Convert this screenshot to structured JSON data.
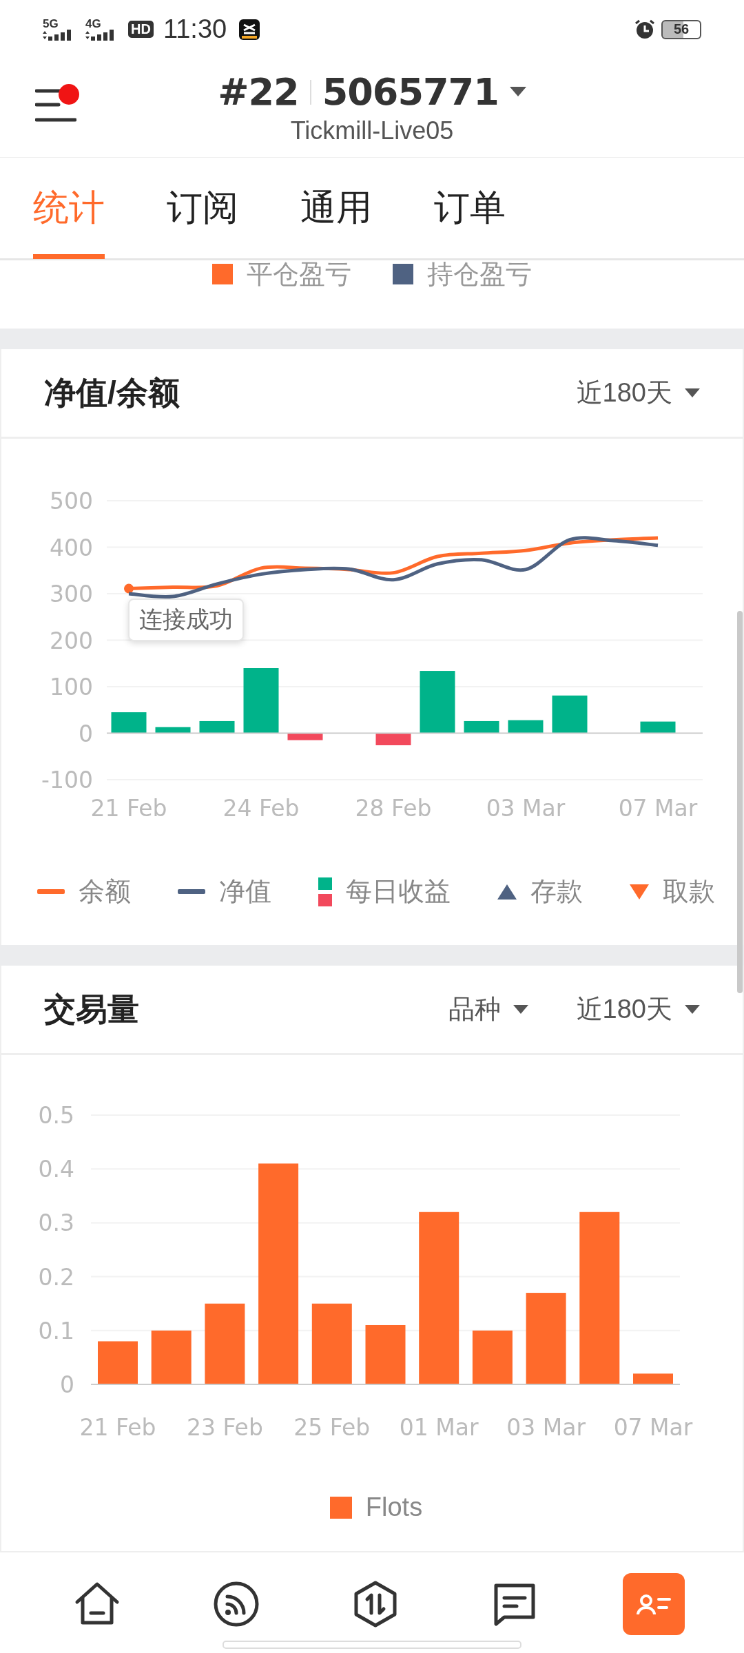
{
  "status_bar": {
    "network_1": "5G",
    "network_2": "4G",
    "hd": "HD",
    "time": "11:30",
    "battery": "56"
  },
  "header": {
    "account_number": "#22",
    "account_id": "5065771",
    "server": "Tickmill-Live05",
    "has_notification": true
  },
  "tabs": [
    {
      "label": "统计",
      "selected": true
    },
    {
      "label": "订阅",
      "selected": false
    },
    {
      "label": "通用",
      "selected": false
    },
    {
      "label": "订单",
      "selected": false
    }
  ],
  "previous_chart_legend": [
    {
      "label": "平仓盈亏",
      "color": "#ff6a2b"
    },
    {
      "label": "持仓盈亏",
      "color": "#4f6282"
    }
  ],
  "equity_card": {
    "title": "净值/余额",
    "dropdowns": [
      {
        "label": "近180天"
      }
    ],
    "toast": "连接成功",
    "chart_data": {
      "type": "bar",
      "categories": [
        "21 Feb",
        null,
        null,
        "24 Feb",
        null,
        null,
        "28 Feb",
        null,
        null,
        "03 Mar",
        null,
        null,
        "07 Mar"
      ],
      "ylim": [
        -100,
        500
      ],
      "yticks": [
        -100,
        0,
        100,
        200,
        300,
        400,
        500
      ],
      "grid": true,
      "series": [
        {
          "name": "余额",
          "type": "line",
          "color": "#ff6a2b",
          "values": [
            311,
            314,
            317,
            355,
            355,
            352,
            345,
            380,
            387,
            393,
            409,
            416,
            420
          ]
        },
        {
          "name": "净值",
          "type": "line",
          "color": "#4f6282",
          "values": [
            300,
            294,
            321,
            342,
            352,
            353,
            330,
            364,
            373,
            352,
            416,
            414,
            404
          ]
        },
        {
          "name": "每日收益",
          "type": "bar",
          "color": "#00b38a",
          "values": [
            45,
            13,
            26,
            140,
            null,
            null,
            null,
            134,
            26,
            28,
            81,
            null,
            25
          ]
        },
        {
          "type": "bar",
          "color": "#f2495c",
          "values": [
            null,
            null,
            null,
            null,
            -15,
            null,
            -26,
            null,
            null,
            null,
            null,
            null,
            null
          ]
        }
      ]
    },
    "extra_legend": [
      {
        "label": "存款",
        "kind": "triangle-up",
        "color": "#4f6282"
      },
      {
        "label": "取款",
        "kind": "triangle-down",
        "color": "#ff6a2b"
      }
    ]
  },
  "volume_card": {
    "title": "交易量",
    "dropdowns": [
      {
        "label": "品种"
      },
      {
        "label": "近180天"
      }
    ],
    "chart_data": {
      "type": "bar",
      "categories": [
        "21 Feb",
        null,
        "23 Feb",
        null,
        "25 Feb",
        null,
        "01 Mar",
        null,
        "03 Mar",
        null,
        "07 Mar"
      ],
      "ylim": [
        0,
        0.5
      ],
      "yticks": [
        0,
        0.1,
        0.2,
        0.3,
        0.4,
        0.5
      ],
      "grid": true,
      "series": [
        {
          "name": "Flots",
          "type": "bar",
          "color": "#ff6a2b",
          "values": [
            0.08,
            0.1,
            0.15,
            0.41,
            0.15,
            0.11,
            0.32,
            0.1,
            0.17,
            0.32,
            0.02
          ]
        }
      ]
    }
  },
  "bottom_nav": [
    {
      "kind": "home",
      "selected": false
    },
    {
      "kind": "feed",
      "selected": false
    },
    {
      "kind": "trade",
      "selected": false
    },
    {
      "kind": "messages",
      "selected": false
    },
    {
      "kind": "profile",
      "selected": true
    }
  ]
}
